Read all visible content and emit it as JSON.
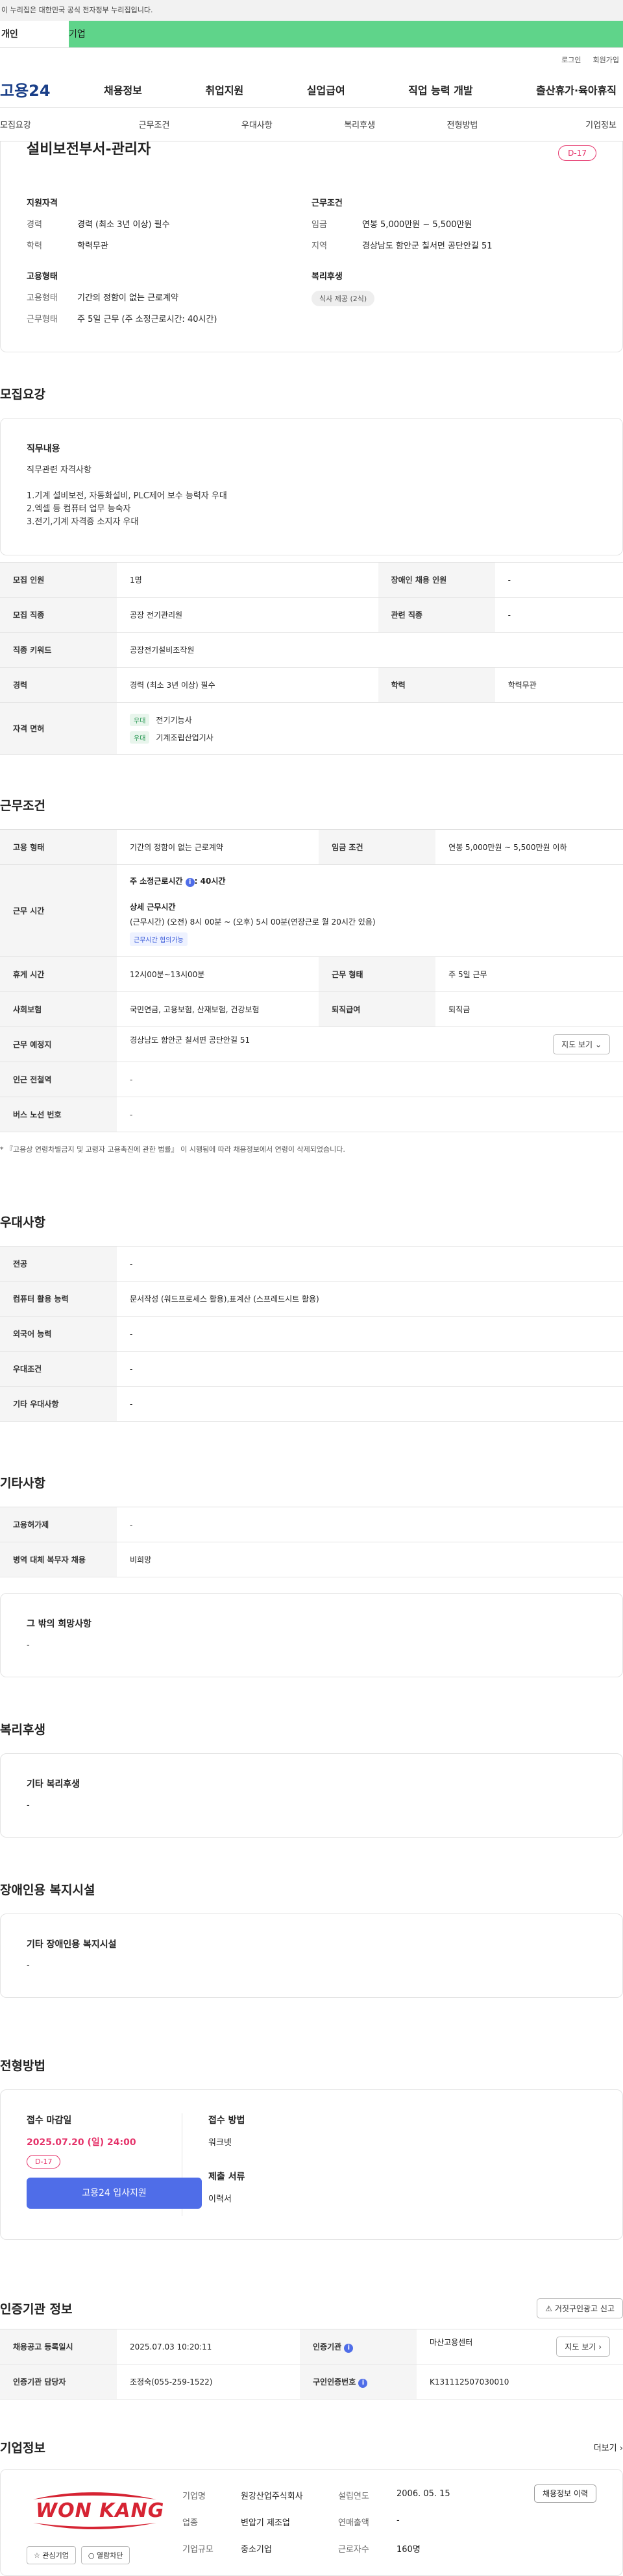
{
  "notice": "이 누리집은 대한민국 공식 전자정부 누리집입니다.",
  "topbar": {
    "personal": "개인",
    "corporate": "기업"
  },
  "util": {
    "login": "로그인",
    "signup": "회원가입"
  },
  "gnb": {
    "logo": "고용24",
    "menu": [
      "채용정보",
      "취업지원",
      "실업급여",
      "직업 능력 개발",
      "출산휴가·육아휴직"
    ]
  },
  "subtabs": [
    "모집요강",
    "근무조건",
    "우대사항",
    "복리후생",
    "전형방법",
    "기업정보"
  ],
  "summary": {
    "title": "설비보전부서-관리자",
    "dday": "D-17",
    "qual_h": "지원자격",
    "qual": [
      [
        "경력",
        "경력 (최소 3년 이상) 필수"
      ],
      [
        "학력",
        "학력무관"
      ]
    ],
    "emp_h": "고용형태",
    "emp": [
      [
        "고용형태",
        "기간의 정함이 없는 근로계약"
      ],
      [
        "근무형태",
        "주 5일 근무 (주 소정근로시간: 40시간)"
      ]
    ],
    "cond_h": "근무조건",
    "cond": [
      [
        "임금",
        "연봉 5,000만원 ~ 5,500만원"
      ],
      [
        "지역",
        "경상남도 함안군 칠서면 공단안길 51"
      ]
    ],
    "welfare_h": "복리후생",
    "welfare_chip": "식사 제공 (2식)"
  },
  "recruit": {
    "title": "모집요강",
    "duty_h": "직무내용",
    "duty": [
      "직무관련 자격사항",
      "",
      "1.기계 설비보전, 자동화설비, PLC제어 보수 능력자 우대",
      "2.엑셀 등 컴퓨터 업무 능숙자",
      "3.전기,기계 자격증 소지자 우대"
    ],
    "rows": [
      {
        "k1": "모집 인원",
        "v1": "1명",
        "k2": "장애인 채용 인원",
        "v2": "-"
      },
      {
        "k1": "모집 직종",
        "v1": "공장 전기관리원",
        "k2": "관련 직종",
        "v2": "-"
      },
      {
        "k1": "직종 키워드",
        "v1": "공장전기설비조작원"
      },
      {
        "k1": "경력",
        "v1": "경력 (최소 3년 이상) 필수",
        "k2": "학력",
        "v2": "학력무관"
      }
    ],
    "license_k": "자격 면허",
    "license_tag": "우대",
    "licenses": [
      "전기기능사",
      "기계조립산업기사"
    ]
  },
  "work": {
    "title": "근무조건",
    "r1": {
      "k1": "고용 형태",
      "v1": "기간의 정함이 없는 근로계약",
      "k2": "임금 조건",
      "v2": "연봉 5,000만원 ~ 5,500만원 이하"
    },
    "hours_k": "근무 시간",
    "hours_main": "주 소정근로시간",
    "hours_val": ": 40시간",
    "hours_detail_h": "상세 근무시간",
    "hours_detail": "(근무시간) (오전) 8시 00분 ~ (오후) 5시 00분(연장근로 월 20시간 있음)",
    "hours_tag": "근무시간 협의가능",
    "rows": [
      {
        "k1": "휴게 시간",
        "v1": "12시00분~13시00분",
        "k2": "근무 형태",
        "v2": "주 5일 근무"
      },
      {
        "k1": "사회보험",
        "v1": "국민연금, 고용보험, 산재보험, 건강보험",
        "k2": "퇴직급여",
        "v2": "퇴직금"
      }
    ],
    "place_k": "근무 예정지",
    "place_v": "경상남도 함안군 칠서면 공단안길 51",
    "map_btn": "지도 보기",
    "station_k": "인근 전철역",
    "station_v": "-",
    "bus_k": "버스 노선 번호",
    "bus_v": "-",
    "note": "* 『고용상 연령차별금지 및 고령자 고용촉진에 관한 법률』 이 시행됨에 따라 채용정보에서 연령이 삭제되었습니다."
  },
  "pref": {
    "title": "우대사항",
    "rows": [
      [
        "전공",
        "-"
      ],
      [
        "컴퓨터 활용 능력",
        "문서작성 (워드프로세스 활용),표계산 (스프레드시트 활용)"
      ],
      [
        "외국어 능력",
        "-"
      ],
      [
        "우대조건",
        "-"
      ],
      [
        "기타 우대사항",
        "-"
      ]
    ]
  },
  "etc": {
    "title": "기타사항",
    "rows": [
      [
        "고용허가제",
        "-"
      ],
      [
        "병역 대체 복무자 채용",
        "비희망"
      ]
    ],
    "other_h": "그 밖의 희망사항",
    "other_v": "-"
  },
  "welfare": {
    "title": "복리후생",
    "h": "기타 복리후생",
    "v": "-"
  },
  "disab": {
    "title": "장애인용 복지시설",
    "h": "기타 장애인용 복지시설",
    "v": "-"
  },
  "select": {
    "title": "전형방법",
    "deadline_h": "접수 마감일",
    "deadline": "2025.07.20 (일) 24:00",
    "dday": "D-17",
    "apply_btn": "고용24 입사지원",
    "method_h": "접수 방법",
    "method": "워크넷",
    "docs_h": "제출 서류",
    "docs": "이력서"
  },
  "cert": {
    "title": "인증기관 정보",
    "report_btn": "거짓구인광고 신고",
    "rows": [
      {
        "k1": "채용공고 등록일시",
        "v1": "2025.07.03 10:20:11",
        "k2": "인증기관",
        "v2": "마산고용센터",
        "btn": "지도 보기"
      },
      {
        "k1": "인증기관 담당자",
        "v1": "조정숙(055-259-1522)",
        "k2": "구인인증번호",
        "v2": "K131112507030010"
      }
    ]
  },
  "company": {
    "title": "기업정보",
    "more": "더보기",
    "logo_text": "WON KANG",
    "interest_btn": "관심기업",
    "block_btn": "열람차단",
    "history_btn": "채용정보 이력",
    "fields": [
      [
        "기업명",
        "원강산업주식회사",
        "설립연도",
        "2006. 05. 15"
      ],
      [
        "업종",
        "변압기 제조업",
        "연매출액",
        "-"
      ],
      [
        "기업규모",
        "중소기업",
        "근로자수",
        "160명"
      ]
    ]
  }
}
